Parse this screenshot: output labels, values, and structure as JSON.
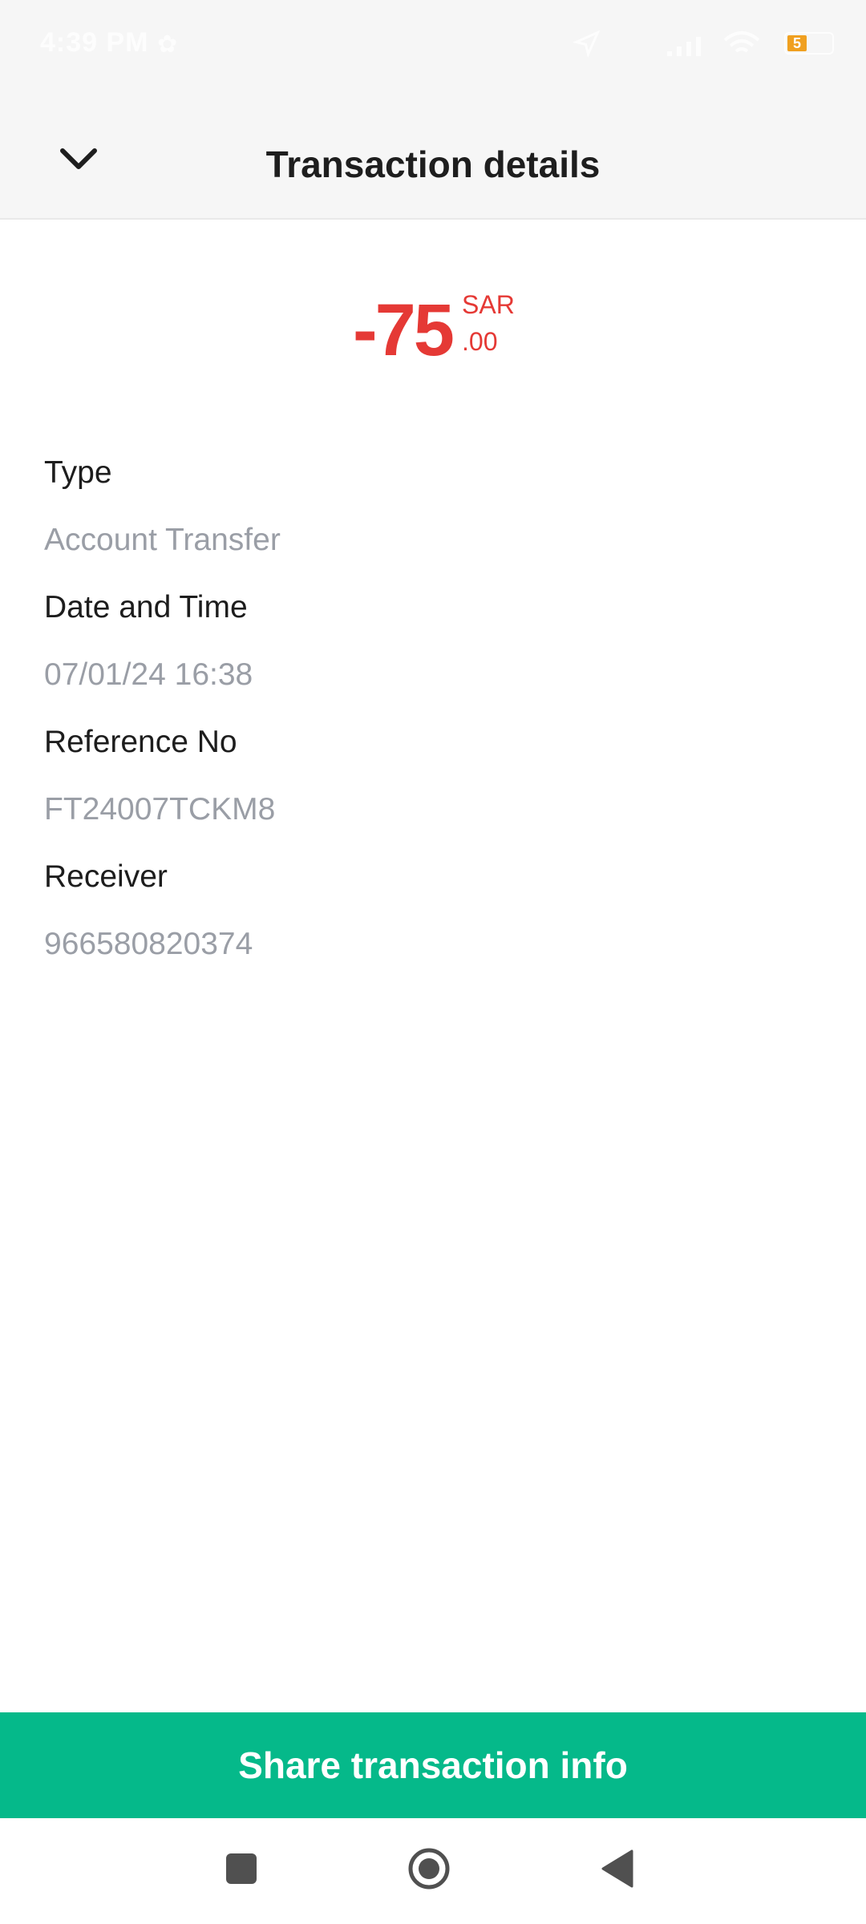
{
  "status_bar": {
    "time": "4:39 PM",
    "battery_level": "5",
    "icons": [
      "settings-icon",
      "location-arrow-icon",
      "signal-icon",
      "wifi-icon",
      "battery-icon"
    ]
  },
  "header": {
    "title": "Transaction details",
    "back_icon": "chevron-down-icon"
  },
  "amount": {
    "main": "-75",
    "currency": "SAR",
    "decimals": ".00",
    "color": "#e53935"
  },
  "details": [
    {
      "label": "Type",
      "value": "Account Transfer"
    },
    {
      "label": "Date and Time",
      "value": "07/01/24 16:38"
    },
    {
      "label": "Reference No",
      "value": "FT24007TCKM8"
    },
    {
      "label": "Receiver",
      "value": "966580820374"
    }
  ],
  "share_button": {
    "label": "Share transaction info",
    "color": "#05b98a"
  },
  "nav_bar": {
    "icons": [
      "recent-apps-icon",
      "home-icon",
      "back-icon"
    ]
  }
}
